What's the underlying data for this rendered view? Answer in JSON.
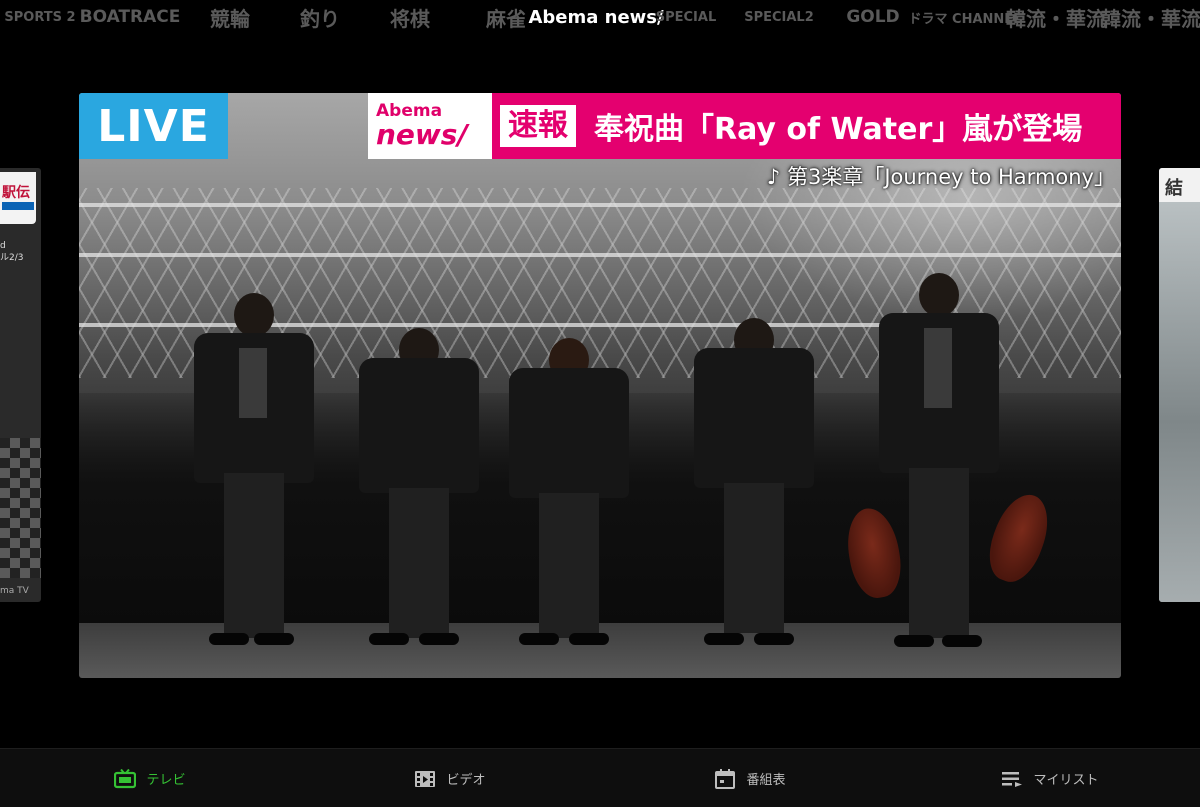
{
  "channels": [
    {
      "label": "SPORTS 2",
      "name": "channel-sports-live-2",
      "style": "small",
      "active": false,
      "width": 80
    },
    {
      "label": "BOATRACE",
      "name": "channel-boatrace",
      "style": "",
      "active": false,
      "width": 100
    },
    {
      "label": "競輪",
      "name": "channel-keirin",
      "style": "serif",
      "active": false,
      "width": 100
    },
    {
      "label": "釣り",
      "name": "channel-fishing",
      "style": "serif",
      "active": false,
      "width": 80
    },
    {
      "label": "将棋",
      "name": "channel-shogi",
      "style": "serif",
      "active": false,
      "width": 100
    },
    {
      "label": "麻雀",
      "name": "channel-mahjong",
      "style": "serif",
      "active": false,
      "width": 92
    },
    {
      "label": "Abema news/",
      "name": "channel-abema-news",
      "style": "",
      "active": true,
      "width": 88
    },
    {
      "label": "SPECIAL",
      "name": "channel-special",
      "style": "small",
      "active": false,
      "width": 92
    },
    {
      "label": "SPECIAL2",
      "name": "channel-special-2",
      "style": "small",
      "active": false,
      "width": 94
    },
    {
      "label": "GOLD",
      "name": "channel-gold",
      "style": "",
      "active": false,
      "width": 94
    },
    {
      "label": "ドラマ CHANNEL",
      "name": "channel-drama",
      "style": "small",
      "active": false,
      "width": 90
    },
    {
      "label": "韓流・華流",
      "name": "channel-k-c-drama",
      "style": "serif",
      "active": false,
      "width": 92
    },
    {
      "label": "韓流・華流",
      "name": "channel-k-c-drama-2",
      "style": "serif",
      "active": false,
      "width": 98
    }
  ],
  "player": {
    "live_badge": "LIVE",
    "news_logo_top": "Abema",
    "news_logo_bottom": "news/",
    "breaking_label": "速報",
    "headline": "奉祝曲「Ray of Water」嵐が登場",
    "subtitle": "♪ 第3楽章「Journey to Harmony」"
  },
  "side_left": {
    "logo": "駅伝",
    "caption_1": "d",
    "caption_2": "ル2/3",
    "watermark": "ma TV"
  },
  "side_right": {
    "label": "結"
  },
  "bottom_nav": [
    {
      "label": "テレビ",
      "icon": "tv-icon",
      "active": true
    },
    {
      "label": "ビデオ",
      "icon": "film-icon",
      "active": false
    },
    {
      "label": "番組表",
      "icon": "calendar-icon",
      "active": false
    },
    {
      "label": "マイリスト",
      "icon": "list-icon",
      "active": false
    }
  ],
  "colors": {
    "accent_green": "#35c234",
    "live_blue": "#2aa7e0",
    "news_pink": "#e4006f"
  }
}
